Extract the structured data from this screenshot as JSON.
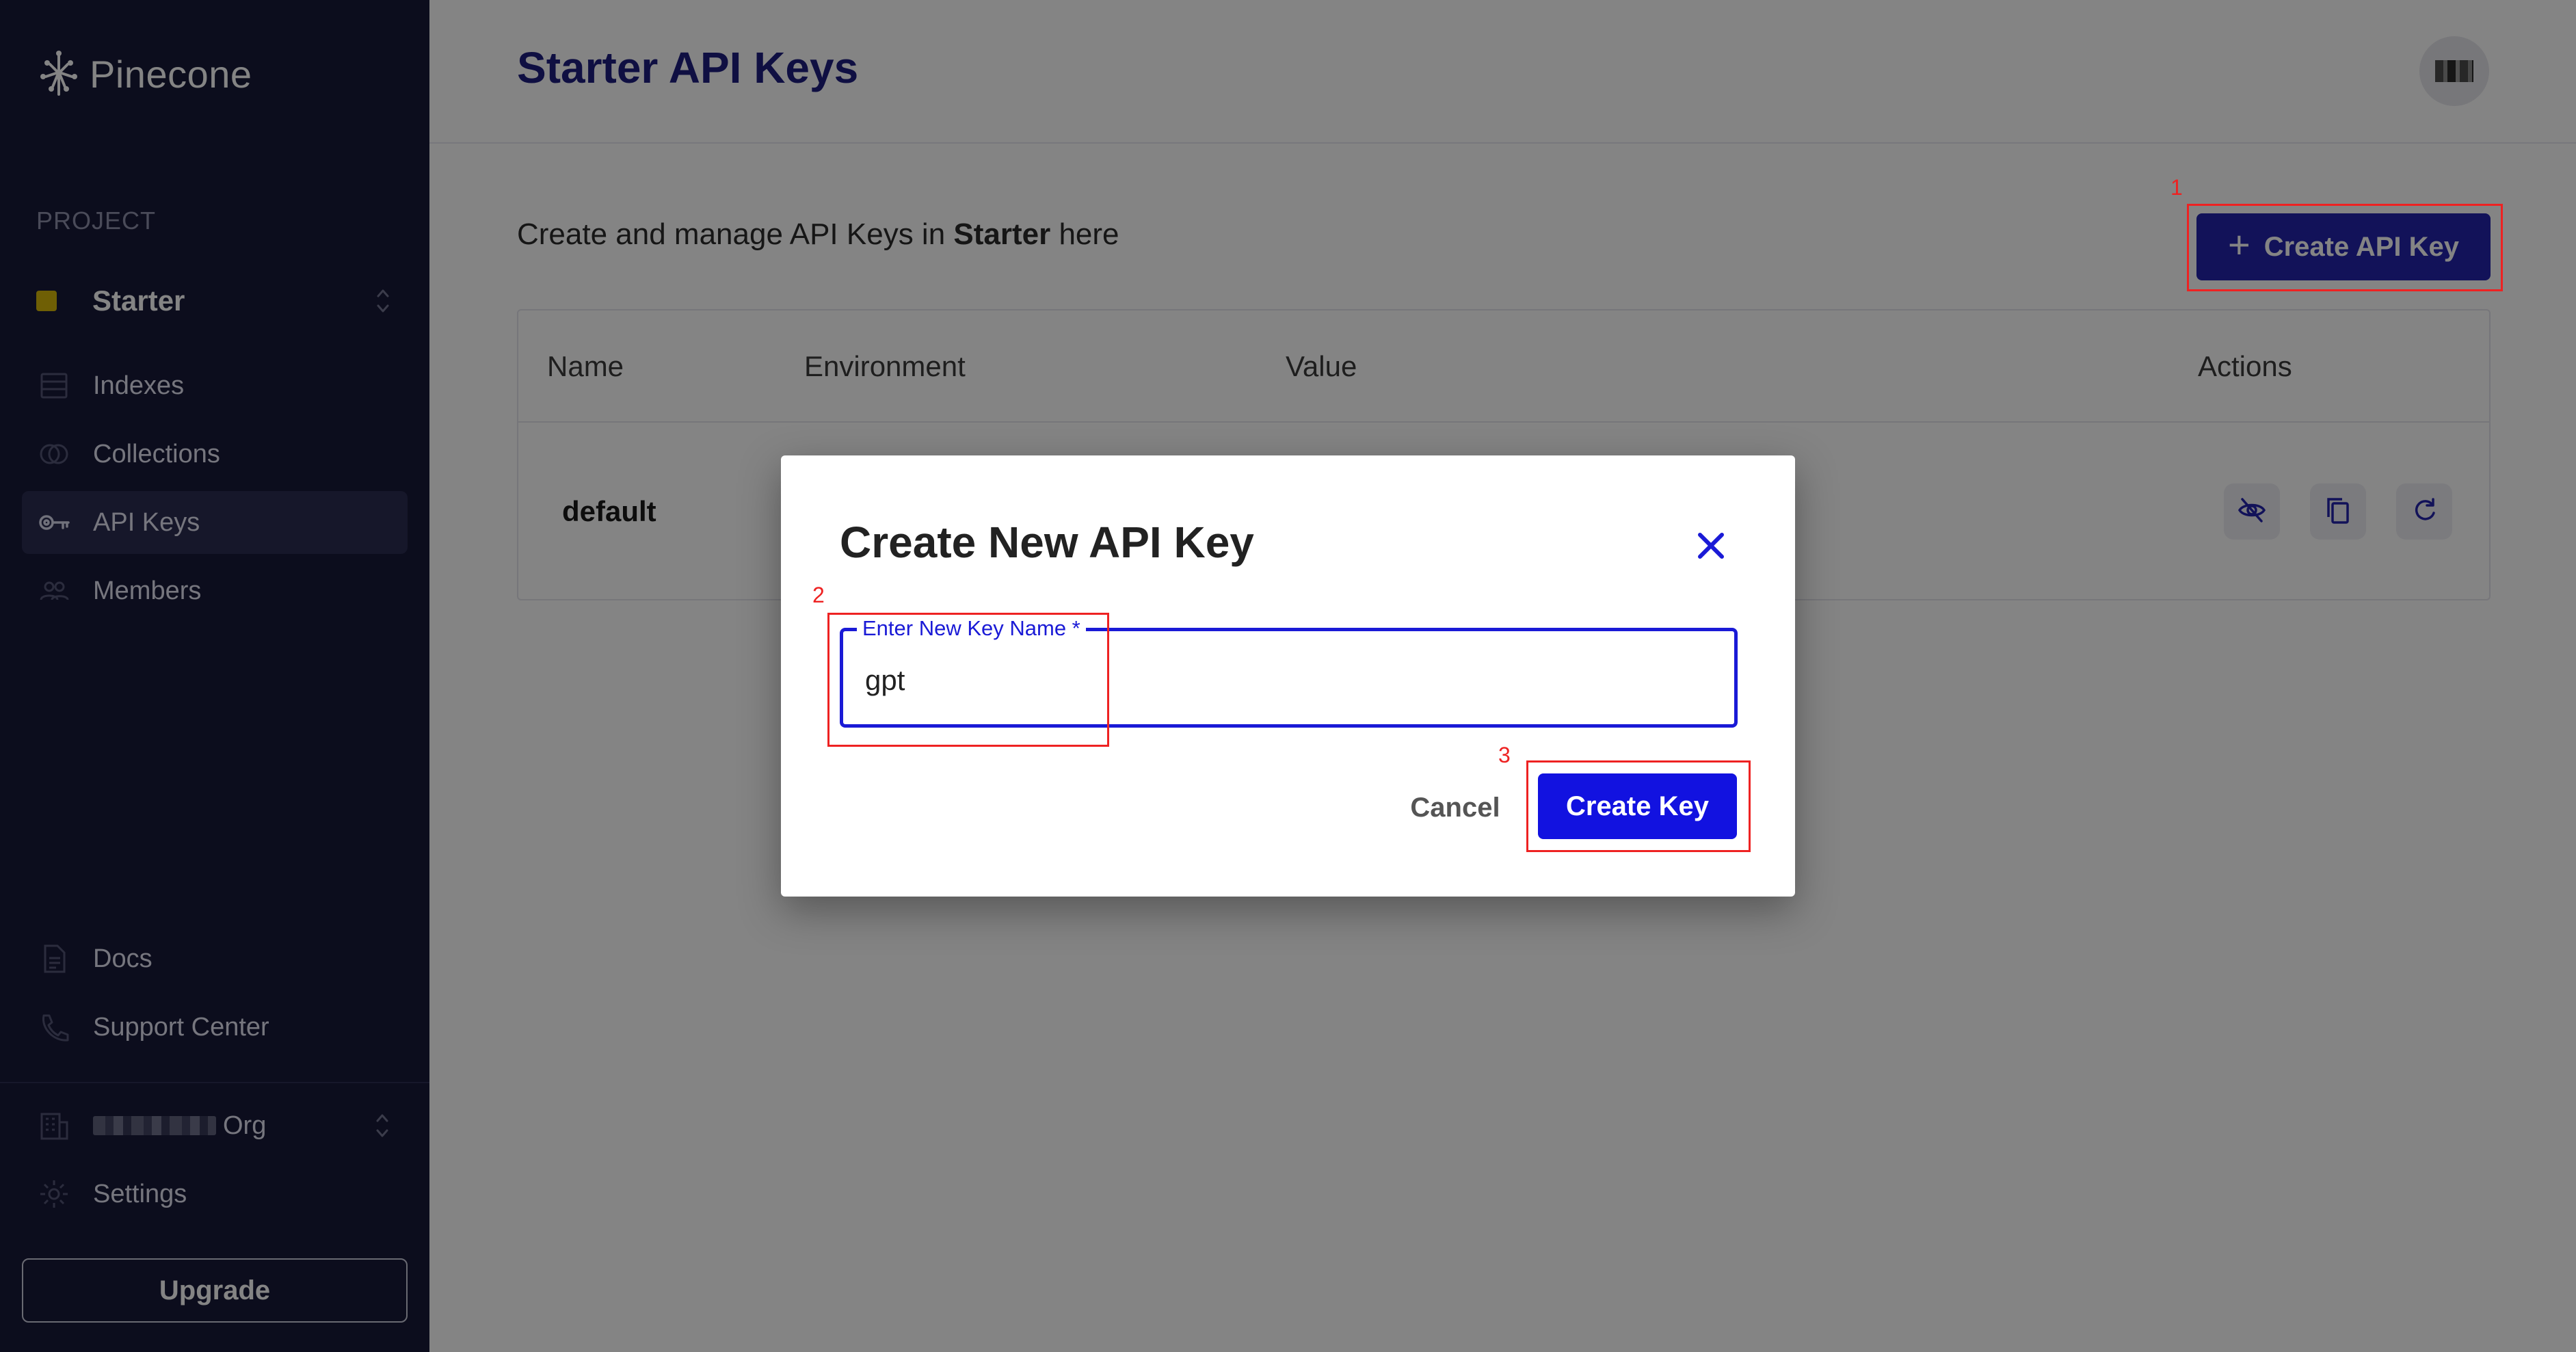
{
  "sidebar": {
    "logo_text": "Pinecone",
    "project_label": "PROJECT",
    "project_name": "Starter",
    "nav": [
      {
        "label": "Indexes",
        "icon": "indexes-icon"
      },
      {
        "label": "Collections",
        "icon": "collections-icon"
      },
      {
        "label": "API Keys",
        "icon": "key-icon",
        "active": true
      },
      {
        "label": "Members",
        "icon": "members-icon"
      }
    ],
    "bottom_nav": [
      {
        "label": "Docs",
        "icon": "document-icon"
      },
      {
        "label": "Support Center",
        "icon": "phone-icon"
      }
    ],
    "org_suffix": "Org",
    "settings_label": "Settings",
    "upgrade_label": "Upgrade"
  },
  "header": {
    "title": "Starter API Keys"
  },
  "main": {
    "subtitle_prefix": "Create and manage API Keys in ",
    "subtitle_project": "Starter",
    "subtitle_suffix": " here",
    "create_button_label": "Create API Key",
    "table": {
      "columns": [
        "Name",
        "Environment",
        "Value",
        "Actions"
      ],
      "rows": [
        {
          "name": "default"
        }
      ]
    }
  },
  "modal": {
    "title": "Create New API Key",
    "field_label": "Enter New Key Name *",
    "field_value": "gpt",
    "cancel_label": "Cancel",
    "submit_label": "Create Key"
  },
  "annotations": [
    "1",
    "2",
    "3"
  ],
  "colors": {
    "sidebar_bg": "#0f1030",
    "primary": "#1a1aa8",
    "modal_primary": "#1212e0",
    "title": "#15157a",
    "marker": "#ee2222"
  }
}
